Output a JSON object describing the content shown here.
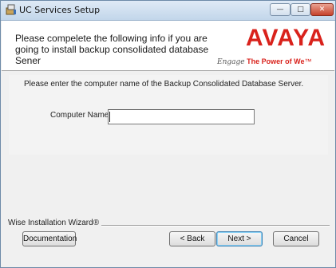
{
  "window": {
    "title": "UC Services Setup"
  },
  "title_controls": {
    "minimize": "—",
    "maximize": "□",
    "close": "✕"
  },
  "header": {
    "text": "Please compelete the following info if you are going to install backup consolidated database Sener",
    "logo_text": "AVAYA",
    "tagline_script": "Engage",
    "tagline_rest": "The Power of We",
    "tagline_tm": "™",
    "brand_color": "#d9221c"
  },
  "form": {
    "instruction": "Please enter the computer name of the Backup Consolidated Database Server.",
    "computer_name_label": "Computer Name",
    "computer_name_value": ""
  },
  "footer": {
    "wizard_label": "Wise Installation Wizard®",
    "documentation": "Documentation",
    "back": "< Back",
    "next": "Next >",
    "cancel": "Cancel"
  }
}
